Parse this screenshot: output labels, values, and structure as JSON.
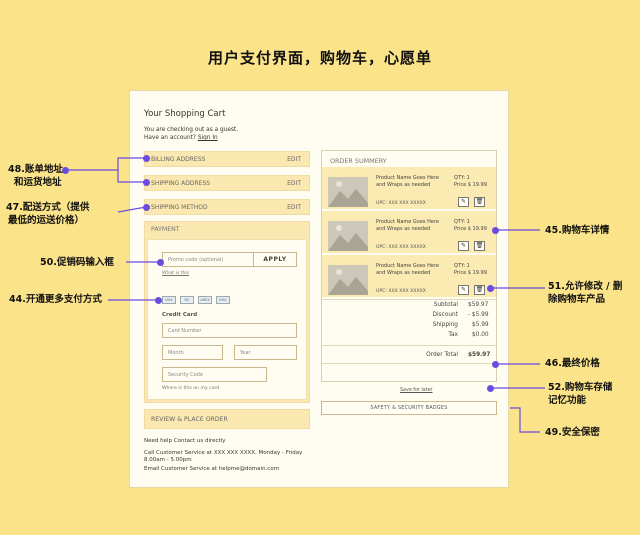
{
  "page_title": "用户支付界面，购物车，心愿单",
  "cart": {
    "title": "Your Shopping Cart",
    "guest_line1": "You are checking out as a guest.",
    "guest_line2": "Have an account?",
    "sign_in": "Sign In"
  },
  "accordion": [
    {
      "label": "BILLING ADDRESS",
      "action": "EDIT"
    },
    {
      "label": "SHIPPING ADDRESS",
      "action": "EDIT"
    },
    {
      "label": "SHIPPING METHOD",
      "action": "EDIT"
    }
  ],
  "payment": {
    "header": "PAYMENT",
    "promo_placeholder": "Promo code (optional)",
    "apply": "APPLY",
    "what_is_this": "What is this",
    "card_types": [
      "VISA",
      "MC",
      "AMEX",
      "DISC"
    ],
    "credit_card_label": "Credit Card",
    "card_number_placeholder": "Card Number",
    "month_placeholder": "Month",
    "year_placeholder": "Year",
    "security_placeholder": "Security Code",
    "where_is_this": "Where is this on my card"
  },
  "review": "REVIEW & PLACE ORDER",
  "help": {
    "heading": "Need help Contact us directly",
    "call": "Call Customer Service at XXX XXX XXXX. Monday - Friday",
    "hours": "8.00am - 5.00pm",
    "email": "Email Customer Service at helpme@domain.com"
  },
  "order": {
    "header": "ORDER SUMMERY",
    "items": [
      {
        "name": "Product Name Goes Here and Wraps as needed",
        "upc": "UPC: XXX XXX XXXXX",
        "qty": "QTY: 1",
        "price": "Price $ 19.99"
      },
      {
        "name": "Product Name Goes Here and Wraps as needed",
        "upc": "UPC: XXX XXX XXXXX",
        "qty": "QTY: 1",
        "price": "Price $ 19.99"
      },
      {
        "name": "Product Name Goes Here and Wraps as needed",
        "upc": "UPC: XXX XXX XXXXX",
        "qty": "QTY: 1",
        "price": "Price $ 19.99"
      }
    ],
    "summary": [
      {
        "label": "Subtotal",
        "value": "$59.97"
      },
      {
        "label": "Discount",
        "value": "- $5.99"
      },
      {
        "label": "Shipping",
        "value": "$5.99"
      },
      {
        "label": "Tax",
        "value": "$0.00"
      }
    ],
    "total_label": "Order Total",
    "total_value": "$59.97"
  },
  "save_for_later": "Save for later",
  "badges": "SAFETY & SECURITY BADGES",
  "annotations": {
    "a48_1": "48.账单地址",
    "a48_2": "和运货地址",
    "a47_1": "47.配送方式（提供",
    "a47_2": "最低的运送价格）",
    "a50": "50.促销码输入框",
    "a44": "44.开通更多支付方式",
    "a45": "45.购物车详情",
    "a51_1": "51.允许修改 / 删",
    "a51_2": "除购物车产品",
    "a46": "46.最终价格",
    "a52_1": "52.购物车存储",
    "a52_2": "记忆功能",
    "a49": "49.安全保密"
  },
  "colors": {
    "background": "#fbe38a",
    "accent": "#6a4ce0",
    "panel": "#fbe8b0"
  }
}
